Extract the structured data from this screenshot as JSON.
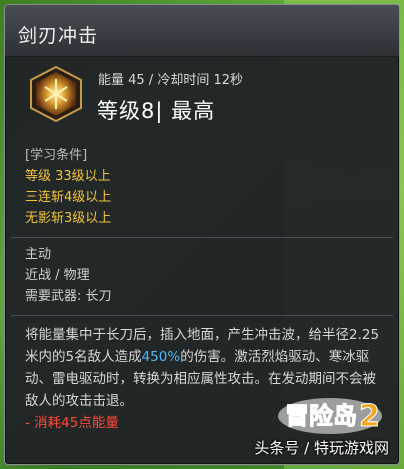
{
  "tooltip": {
    "title": "剑刃冲击",
    "meta": "能量 45 / 冷却时间 12秒",
    "level": "等级8| 最高"
  },
  "requirements": {
    "title": "[学习条件]",
    "items": [
      "等级 33级以上",
      "三连斩4级以上",
      "无影斩3级以上"
    ]
  },
  "skill_type": {
    "kind": "主动",
    "category": "近战 / 物理",
    "weapon": "需要武器: 长刀"
  },
  "description": {
    "part1": "将能量集中于长刀后，插入地面，产生冲击波，给半径2.25米内的5名敌人造成",
    "highlight": "450%",
    "part2": "的伤害。激活烈焰驱动、寒冰驱动、雷电驱动时，转换为相应属性攻击。在发动期间不会被敌人的攻击击退。",
    "cost": "- 消耗45点能量"
  },
  "watermark": "头条号 / 特玩游戏网",
  "logo_text": "冒险岛2",
  "colors": {
    "requirement": "#f2c33c",
    "highlight": "#4ab8ff",
    "cost": "#ff4a3a"
  }
}
